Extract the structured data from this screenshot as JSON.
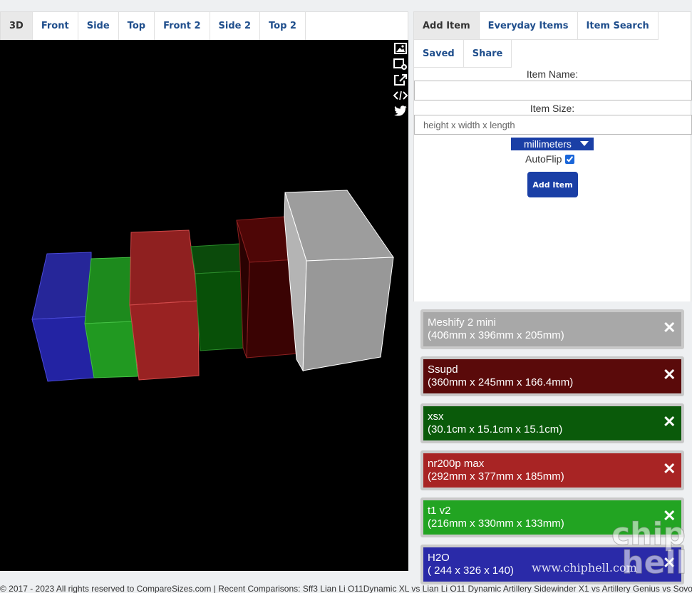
{
  "view_tabs": [
    "3D",
    "Front",
    "Side",
    "Top",
    "Front 2",
    "Side 2",
    "Top 2"
  ],
  "right_tabs": [
    "Add Item",
    "Everyday Items",
    "Item Search",
    "Saved",
    "Share"
  ],
  "add_item": {
    "name_label": "Item Name:",
    "name_value": "",
    "size_label": "Item Size:",
    "size_placeholder": "height x width x length",
    "unit_selected": "millimeters",
    "autoflip_label": "AutoFlip",
    "autoflip_checked": true,
    "button_label": "Add Item"
  },
  "items": [
    {
      "name": "Meshify 2 mini",
      "size": "(406mm x 396mm x 205mm)",
      "color": "#a8a8a8",
      "close": "✕"
    },
    {
      "name": "Ssupd",
      "size": "(360mm x 245mm x 166.4mm)",
      "color": "#5a0a0a",
      "close": "✕"
    },
    {
      "name": "xsx",
      "size": "(30.1cm x 15.1cm x 15.1cm)",
      "color": "#0a5a0a",
      "close": "✕"
    },
    {
      "name": "nr200p max",
      "size": "(292mm x 377mm x 185mm)",
      "color": "#a82424",
      "close": "✕"
    },
    {
      "name": "t1 v2",
      "size": "(216mm x 330mm x 133mm)",
      "color": "#22a422",
      "close": "✕"
    },
    {
      "name": "H2O",
      "size": "( 244 x 326 x 140)",
      "color": "#2a2aa8",
      "close": "✕"
    }
  ],
  "toolbar_icons": [
    "image-icon",
    "add-window-icon",
    "share-out-icon",
    "code-icon",
    "twitter-icon"
  ],
  "footer": "© 2017 - 2023 All rights reserved to CompareSizes.com | Recent Comparisons: Sff3 Lian Li O11Dynamic XL vs Lian Li O11 Dynamic Artillery Sidewinder X1 vs Artillery Genius vs Sovol S",
  "watermark": {
    "site": "www.chiphell.com",
    "logo_text": "chip hell"
  }
}
